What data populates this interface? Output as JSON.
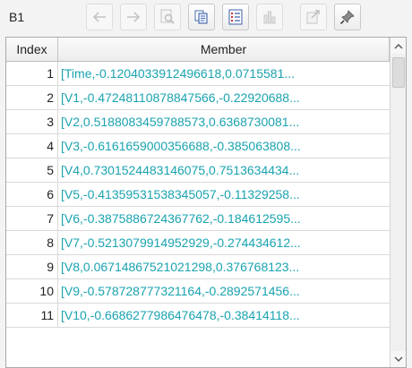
{
  "cell_ref": "B1",
  "toolbar": {
    "buttons": [
      {
        "name": "back-button",
        "icon": "arrow-left-icon",
        "enabled": false
      },
      {
        "name": "forward-button",
        "icon": "arrow-right-icon",
        "enabled": false
      },
      {
        "name": "find-button",
        "icon": "magnifier-page-icon",
        "enabled": false
      },
      {
        "name": "copy-button",
        "icon": "copy-icon",
        "enabled": true
      },
      {
        "name": "list-view-button",
        "icon": "list-icon",
        "enabled": true
      },
      {
        "name": "chart-button",
        "icon": "bar-chart-icon",
        "enabled": false
      },
      {
        "name": "export-button",
        "icon": "export-icon",
        "enabled": false
      },
      {
        "name": "pin-button",
        "icon": "pin-icon",
        "enabled": true
      }
    ]
  },
  "table": {
    "headers": {
      "index": "Index",
      "member": "Member"
    },
    "rows": [
      {
        "index": "1",
        "member": "[Time,-0.1204033912496618,0.0715581..."
      },
      {
        "index": "2",
        "member": "[V1,-0.47248110878847566,-0.22920688..."
      },
      {
        "index": "3",
        "member": "[V2,0.5188083459788573,0.6368730081..."
      },
      {
        "index": "4",
        "member": "[V3,-0.6161659000356688,-0.385063808..."
      },
      {
        "index": "5",
        "member": "[V4,0.7301524483146075,0.7513634434..."
      },
      {
        "index": "6",
        "member": "[V5,-0.41359531538345057,-0.11329258..."
      },
      {
        "index": "7",
        "member": "[V6,-0.3875886724367762,-0.184612595..."
      },
      {
        "index": "8",
        "member": "[V7,-0.5213079914952929,-0.274434612..."
      },
      {
        "index": "9",
        "member": "[V8,0.06714867521021298,0.376768123..."
      },
      {
        "index": "10",
        "member": "[V9,-0.578728777321164,-0.2892571456..."
      },
      {
        "index": "11",
        "member": "[V10,-0.6686277986476478,-0.38414118..."
      }
    ]
  },
  "colors": {
    "member_text": "#1aa3b0"
  }
}
